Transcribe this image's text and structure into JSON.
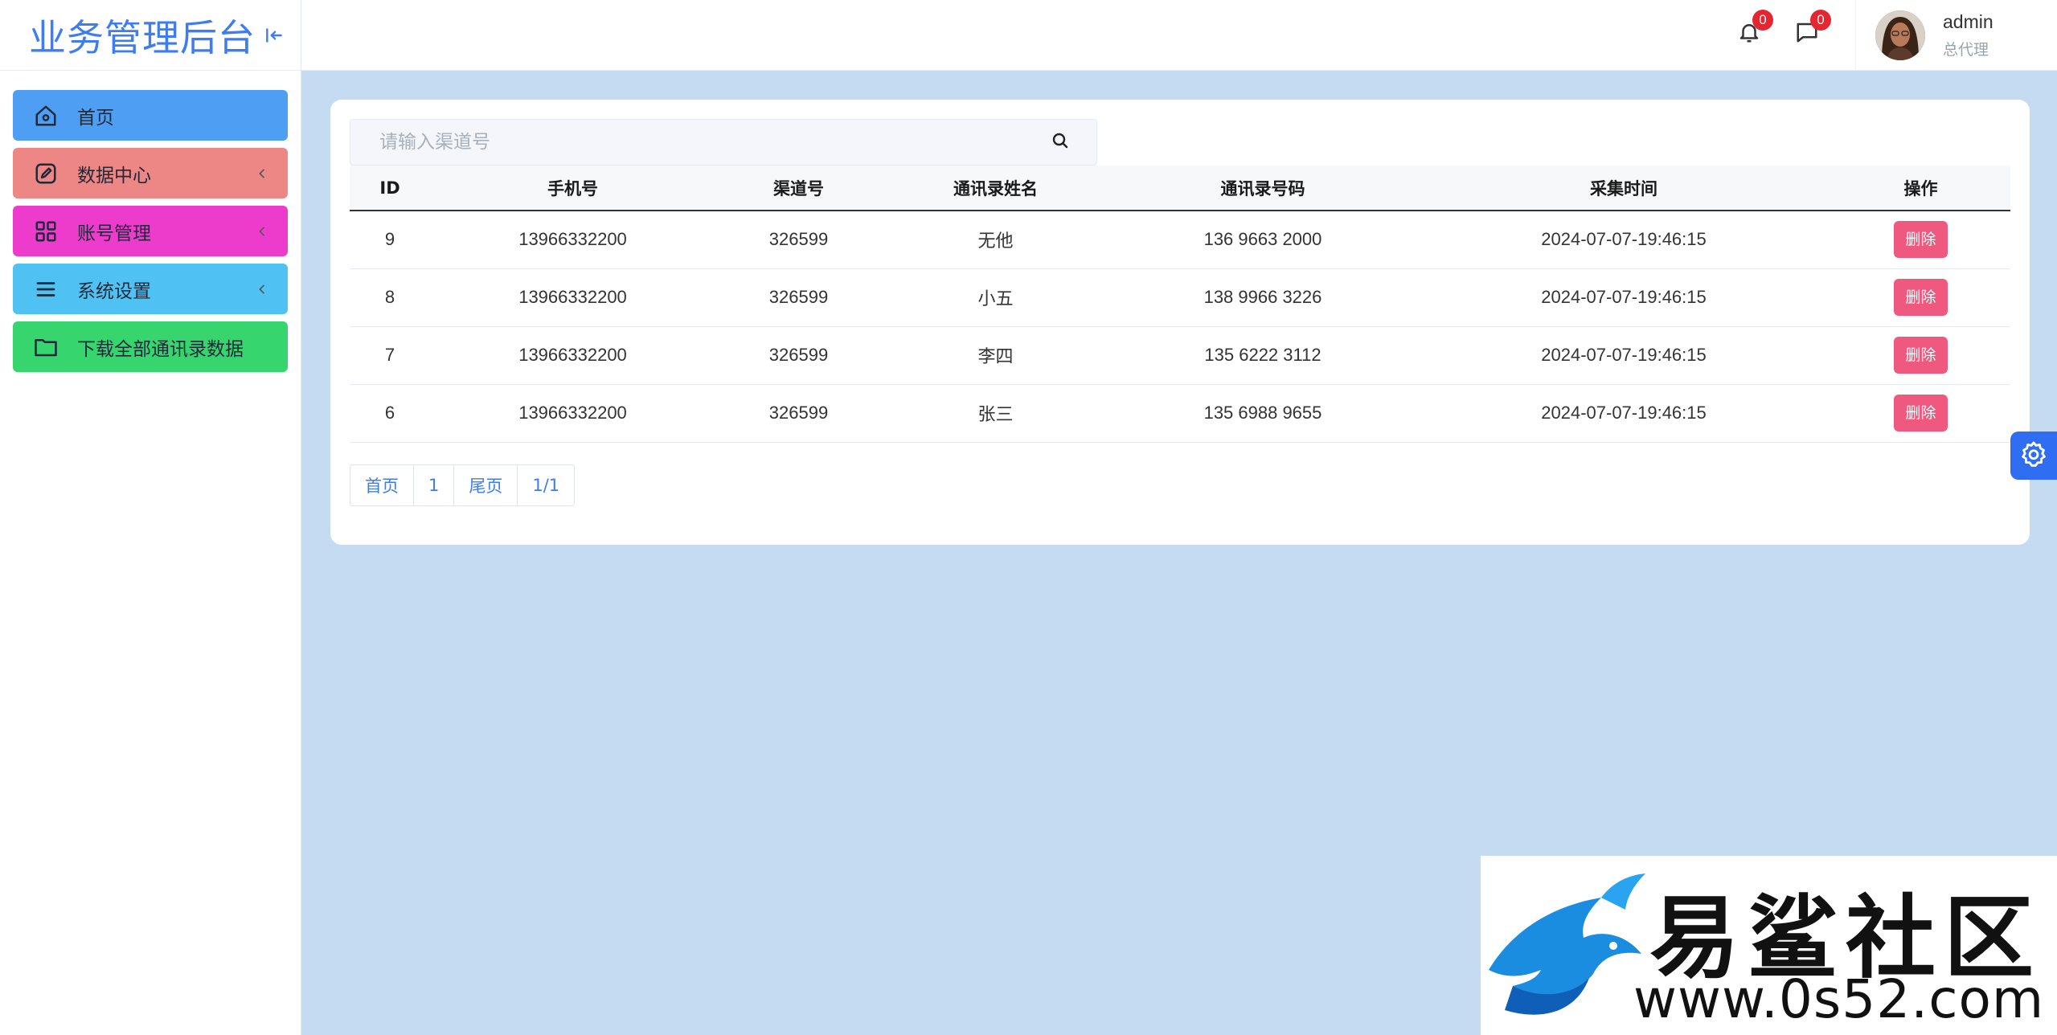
{
  "app": {
    "title": "业务管理后台"
  },
  "sidebar": {
    "items": [
      {
        "label": "首页",
        "icon": "home-icon",
        "color": "#4e9ef3",
        "has_arrow": false
      },
      {
        "label": "数据中心",
        "icon": "edit-icon",
        "color": "#ec8786",
        "has_arrow": true
      },
      {
        "label": "账号管理",
        "icon": "grid-icon",
        "color": "#ed3ccc",
        "has_arrow": true
      },
      {
        "label": "系统设置",
        "icon": "menu-icon",
        "color": "#4fc2f3",
        "has_arrow": true
      },
      {
        "label": "下载全部通讯录数据",
        "icon": "folder-icon",
        "color": "#37d56e",
        "has_arrow": false
      }
    ]
  },
  "header": {
    "notifications_count": "0",
    "messages_count": "0",
    "user": {
      "name": "admin",
      "role": "总代理"
    }
  },
  "search": {
    "placeholder": "请输入渠道号"
  },
  "table": {
    "columns": [
      "ID",
      "手机号",
      "渠道号",
      "通讯录姓名",
      "通讯录号码",
      "采集时间",
      "操作"
    ],
    "rows": [
      {
        "id": "9",
        "phone": "13966332200",
        "channel": "326599",
        "name": "无他",
        "number": "136 9663 2000",
        "time": "2024-07-07-19:46:15",
        "action": "删除"
      },
      {
        "id": "8",
        "phone": "13966332200",
        "channel": "326599",
        "name": "小五",
        "number": "138 9966 3226",
        "time": "2024-07-07-19:46:15",
        "action": "删除"
      },
      {
        "id": "7",
        "phone": "13966332200",
        "channel": "326599",
        "name": "李四",
        "number": "135 6222 3112",
        "time": "2024-07-07-19:46:15",
        "action": "删除"
      },
      {
        "id": "6",
        "phone": "13966332200",
        "channel": "326599",
        "name": "张三",
        "number": "135 6988 9655",
        "time": "2024-07-07-19:46:15",
        "action": "删除"
      }
    ]
  },
  "pagination": {
    "first": "首页",
    "current": "1",
    "last": "尾页",
    "summary": "1/1"
  },
  "watermark": {
    "title": "易鲨社区",
    "url": "www.0s52.com"
  },
  "colors": {
    "accent": "#3d7cf2",
    "background": "#c5dbf2",
    "delete": "#f0597f",
    "badge": "#e5252f"
  }
}
